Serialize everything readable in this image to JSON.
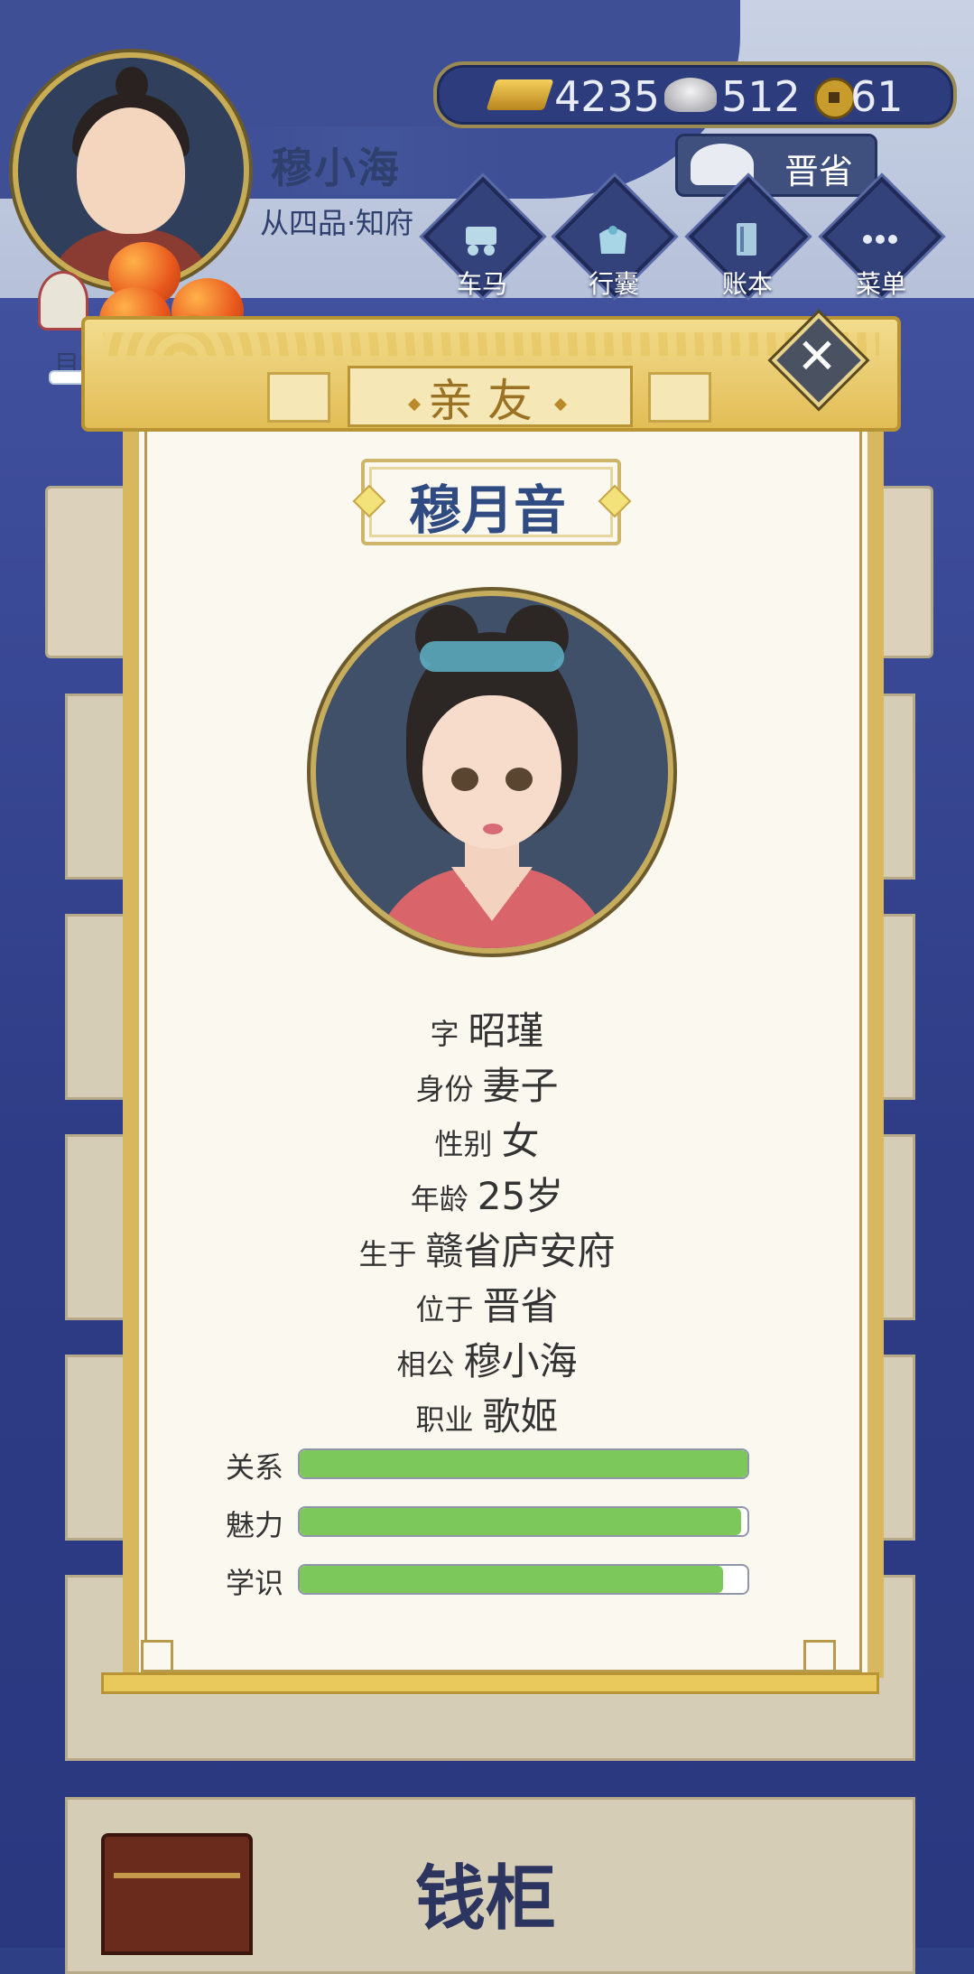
{
  "player": {
    "name": "穆小海",
    "rank": "从四品·知府"
  },
  "currency": {
    "gold": "4235",
    "silver": "512",
    "coins": "61"
  },
  "location": "晋省",
  "menu": [
    {
      "label": "车马",
      "icon": "carriage-icon"
    },
    {
      "label": "行囊",
      "icon": "bag-icon"
    },
    {
      "label": "账本",
      "icon": "ledger-icon"
    },
    {
      "label": "菜单",
      "icon": "more-icon"
    }
  ],
  "goal_label": "目标",
  "background": {
    "vault_title": "钱柜"
  },
  "modal": {
    "title": "亲友",
    "close_icon": "close-icon",
    "character_name": "穆月音",
    "details": [
      {
        "label": "字",
        "value": "昭瑾"
      },
      {
        "label": "身份",
        "value": "妻子"
      },
      {
        "label": "性别",
        "value": "女"
      },
      {
        "label": "年龄",
        "value": "25岁"
      },
      {
        "label": "生于",
        "value": "赣省庐安府"
      },
      {
        "label": "位于",
        "value": "晋省"
      },
      {
        "label": "相公",
        "value": "穆小海"
      },
      {
        "label": "职业",
        "value": "歌姬"
      }
    ],
    "stats": [
      {
        "label": "关系",
        "fraction": 1.0
      },
      {
        "label": "魅力",
        "fraction": 0.985
      },
      {
        "label": "学识",
        "fraction": 0.945
      }
    ]
  },
  "colors": {
    "accent_blue": "#2f4b82",
    "gold_frame": "#d8b85e",
    "stat_green": "#7dc85a",
    "paper": "#fbf8ef"
  }
}
